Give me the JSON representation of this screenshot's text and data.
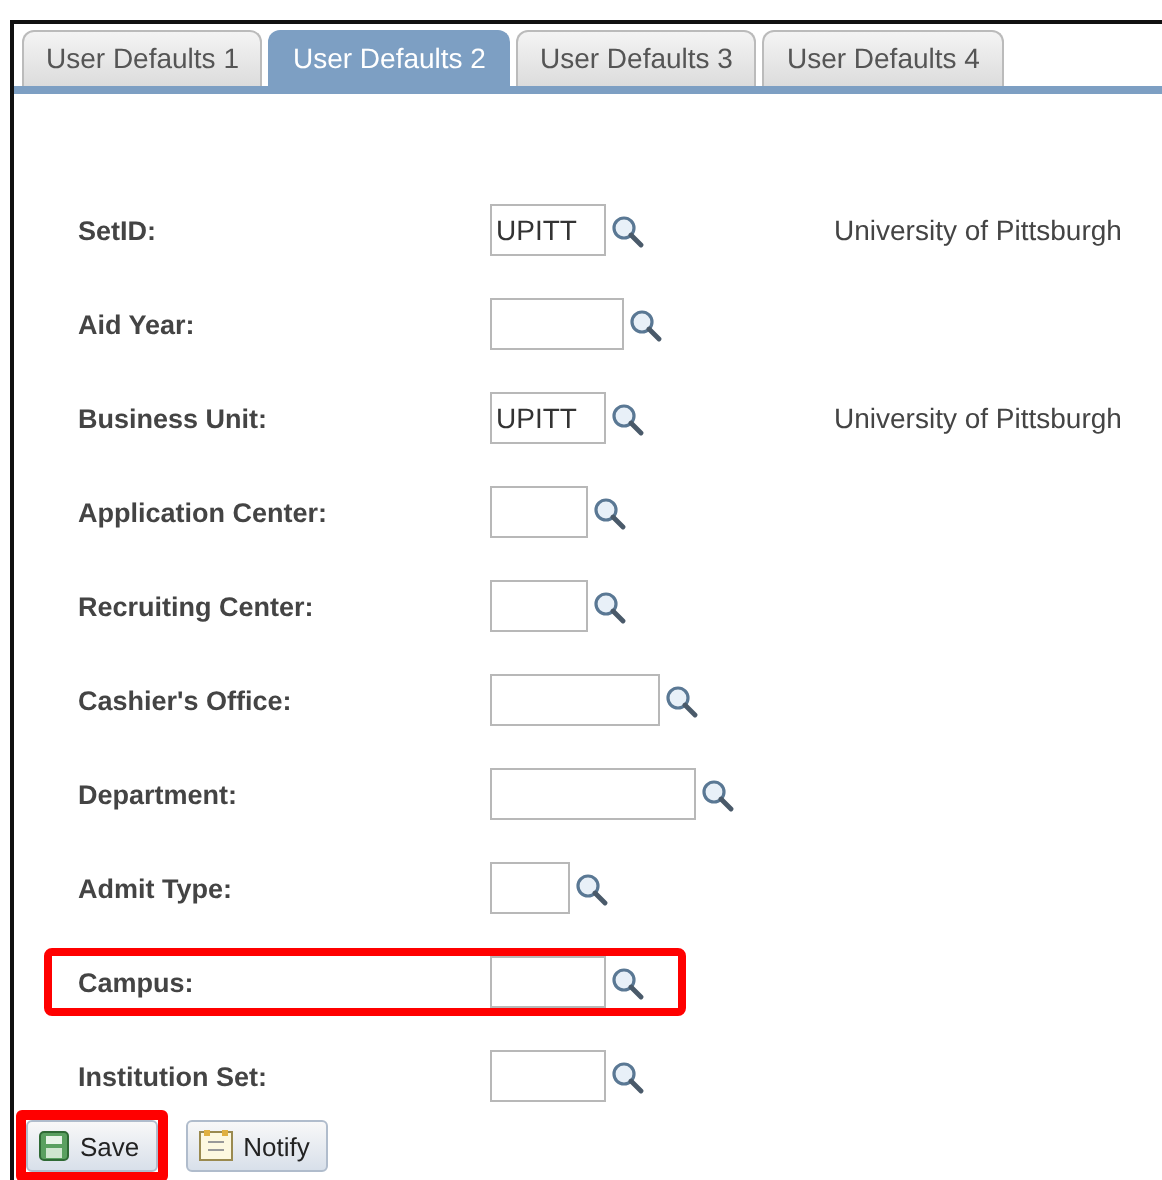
{
  "tabs": [
    {
      "label": "User Defaults 1",
      "selected": false
    },
    {
      "label": "User Defaults 2",
      "selected": true
    },
    {
      "label": "User Defaults 3",
      "selected": false
    },
    {
      "label": "User Defaults 4",
      "selected": false
    }
  ],
  "fields": [
    {
      "label": "SetID:",
      "value": "UPITT",
      "description": "University of Pittsburgh",
      "highlighted": false
    },
    {
      "label": "Aid Year:",
      "highlighted": false
    },
    {
      "label": "Business Unit:",
      "value": "UPITT",
      "description": "University of Pittsburgh",
      "highlighted": false
    },
    {
      "label": "Application Center:",
      "highlighted": false
    },
    {
      "label": "Recruiting Center:",
      "highlighted": false
    },
    {
      "label": "Cashier's Office:",
      "highlighted": false
    },
    {
      "label": "Department:",
      "highlighted": false
    },
    {
      "label": "Admit Type:",
      "highlighted": false
    },
    {
      "label": "Campus:",
      "highlighted": true
    },
    {
      "label": "Institution Set:",
      "highlighted": false
    }
  ],
  "buttons": [
    {
      "label": "Save",
      "kind": "save",
      "highlighted": true
    },
    {
      "label": "Notify",
      "kind": "notify",
      "highlighted": false
    }
  ]
}
